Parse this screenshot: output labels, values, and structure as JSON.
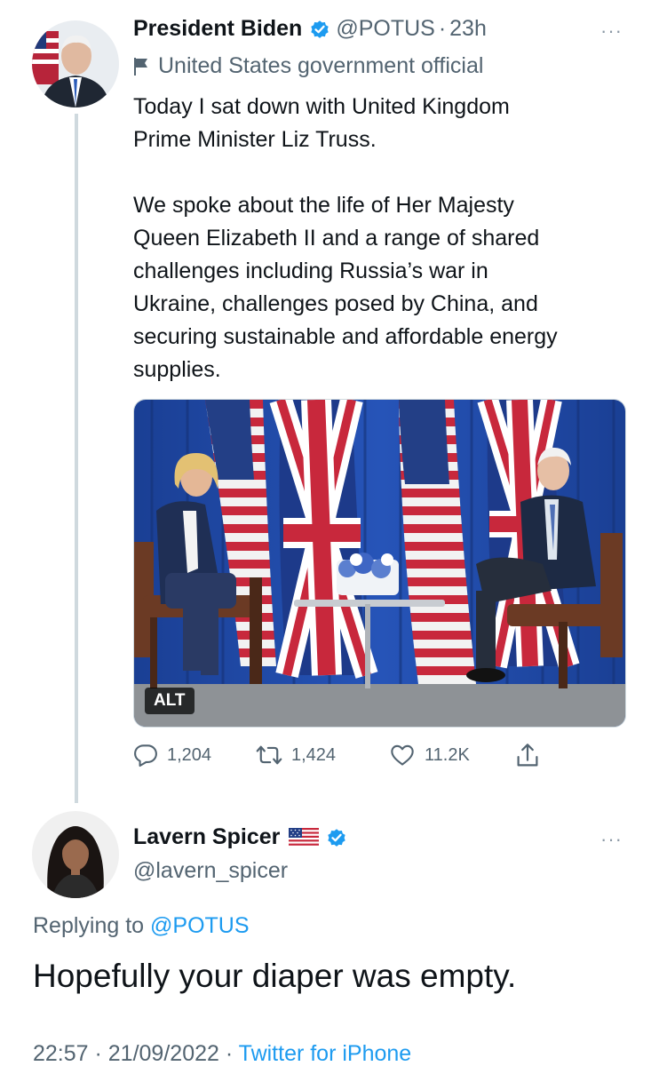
{
  "tweet": {
    "author_name": "President Biden",
    "handle": "@POTUS",
    "separator": "·",
    "time_ago": "23h",
    "more": "···",
    "label": "United States government official",
    "text": "Today I sat down with United Kingdom\nPrime Minister Liz Truss.\n\nWe spoke about the life of Her Majesty\nQueen Elizabeth II and a range of shared\nchallenges including Russia’s war in\nUkraine, challenges posed by China, and\nsecuring sustainable and affordable energy\nsupplies.",
    "media": {
      "alt_badge": "ALT"
    },
    "actions": {
      "replies": "1,204",
      "retweets": "1,424",
      "likes": "11.2K"
    },
    "icons": [
      "verified-badge-icon",
      "flag-label-icon",
      "reply-icon",
      "retweet-icon",
      "like-icon",
      "share-icon"
    ]
  },
  "reply": {
    "author_name": "Lavern Spicer",
    "handle": "@lavern_spicer",
    "more": "···",
    "replying_prefix": "Replying to",
    "replying_to": "@POTUS",
    "text": "Hopefully your diaper was empty.",
    "timestamp": "22:57 · 21/09/2022 ·",
    "source": "Twitter for iPhone",
    "icons": [
      "us-flag-icon",
      "verified-badge-icon"
    ]
  },
  "colors": {
    "accent": "#1d9bf0",
    "secondary_text": "#536471",
    "thread_line": "#cfd9de"
  }
}
